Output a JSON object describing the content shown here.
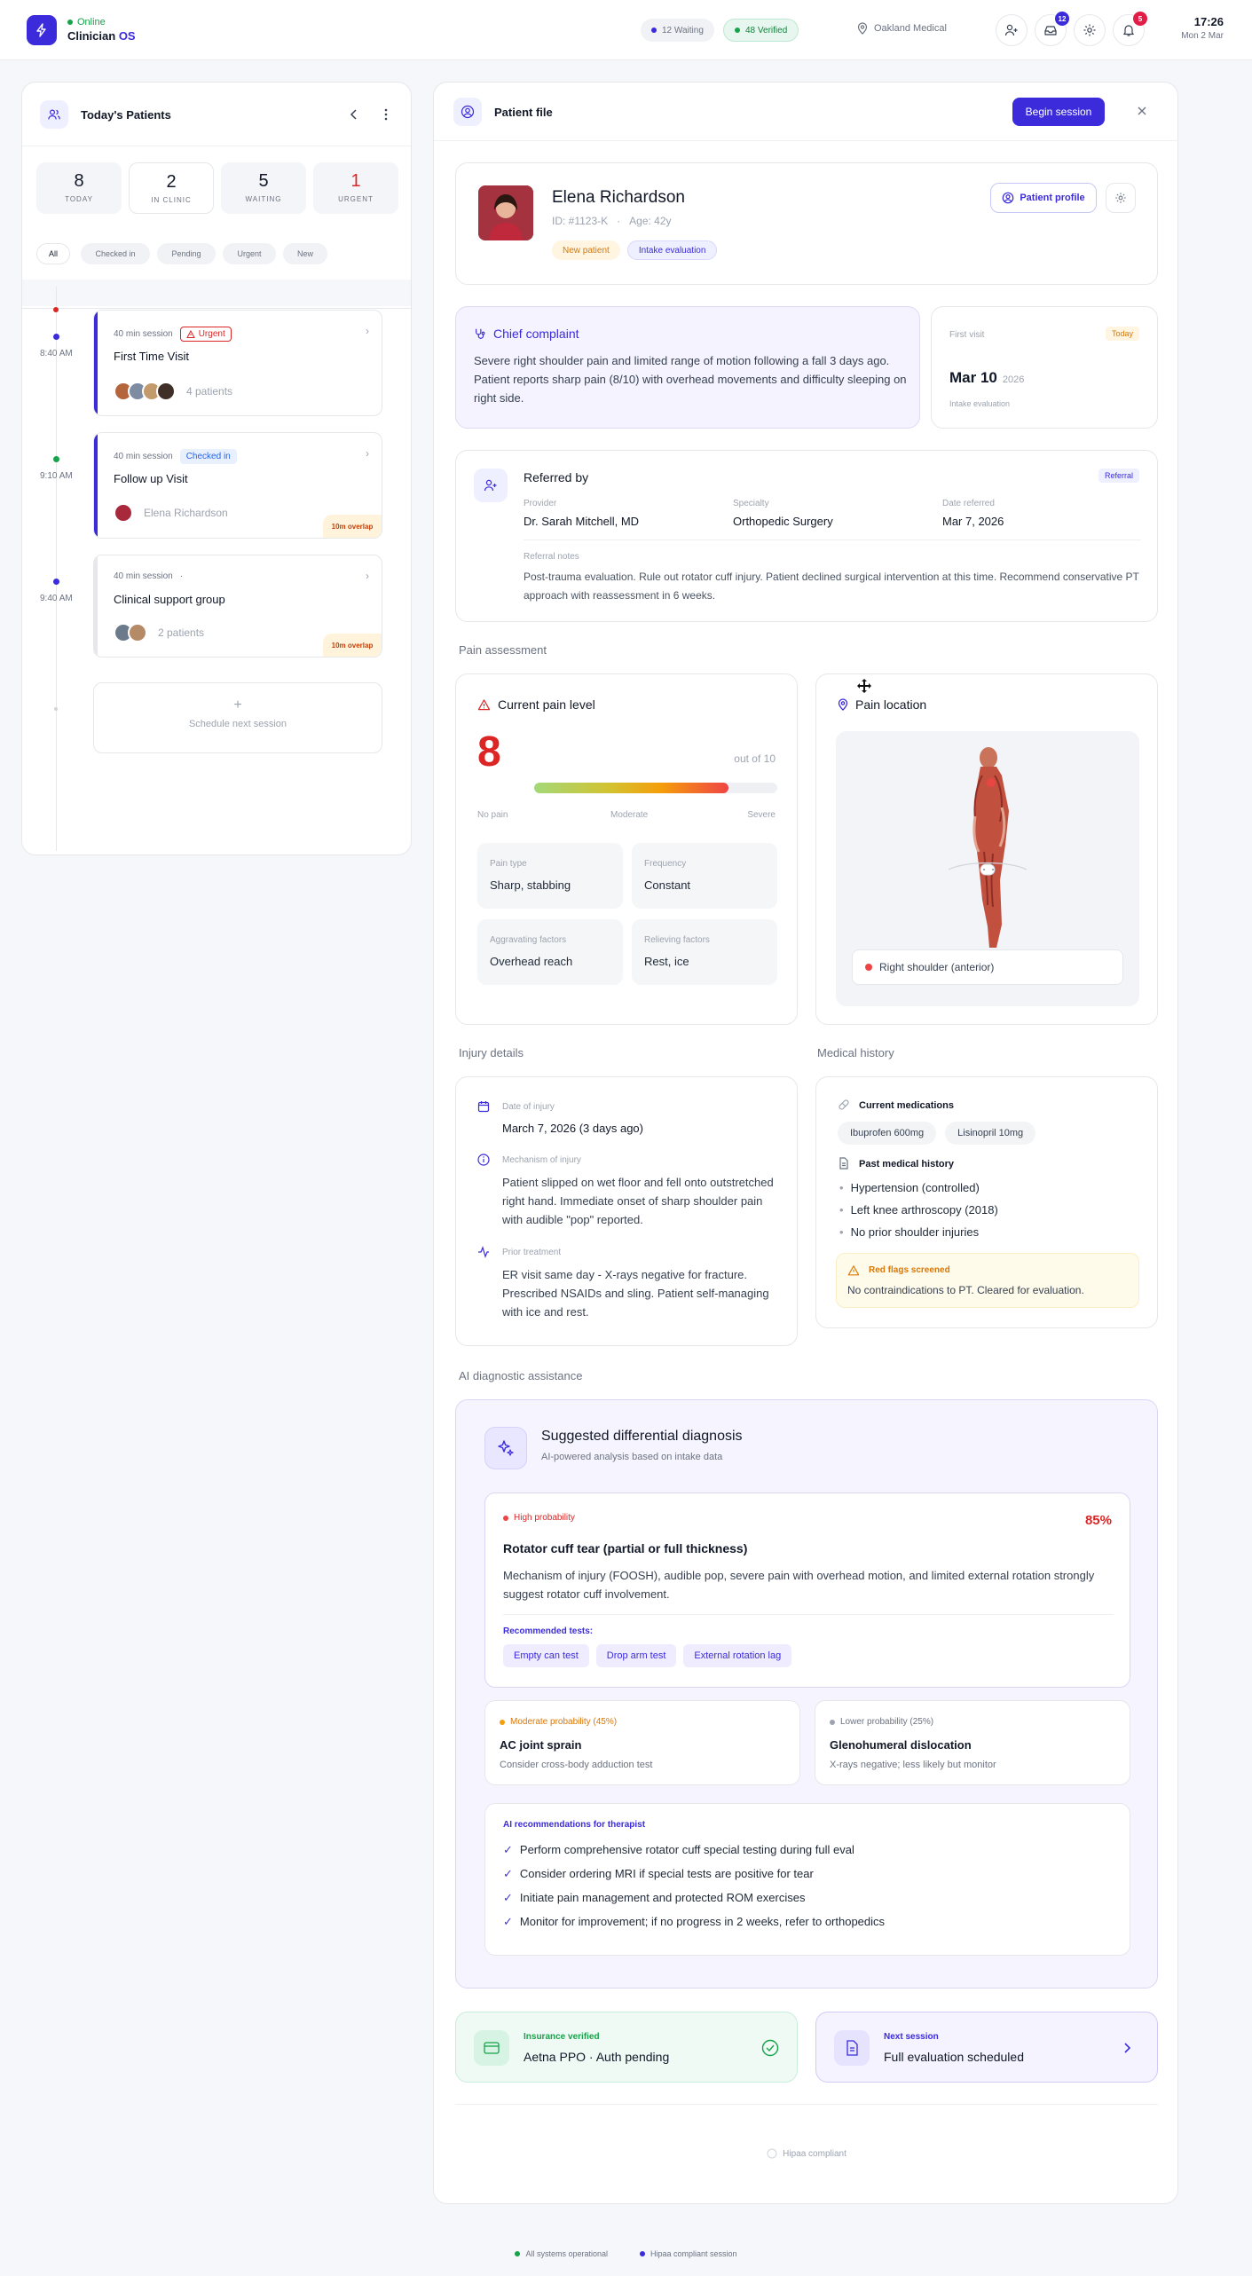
{
  "topbar": {
    "status": "Online",
    "brand_main": "Clinician",
    "brand_accent": "OS",
    "waiting_pill": "12 Waiting",
    "verified_pill": "48 Verified",
    "location": "Oakland Medical",
    "inbox_badge": "12",
    "notif_badge": "5",
    "time": "17:26",
    "date": "Mon 2 Mar"
  },
  "colors": {
    "accent": "#3b2bdb",
    "urgent": "#dc2626",
    "success": "#16a34a",
    "warning": "#f59e0b"
  },
  "left": {
    "title": "Today's Patients",
    "stats": [
      {
        "num": "8",
        "label": "TODAY"
      },
      {
        "num": "2",
        "label": "IN CLINIC"
      },
      {
        "num": "5",
        "label": "WAITING"
      },
      {
        "num": "1",
        "label": "URGENT"
      }
    ],
    "filters": [
      "All",
      "Checked in",
      "Pending",
      "Urgent",
      "New"
    ],
    "sessions": [
      {
        "time": "8:40 AM",
        "duration": "40 min session",
        "tag": "Urgent",
        "name": "First Time Visit",
        "people": "4 patients"
      },
      {
        "time": "9:10 AM",
        "duration": "40 min session",
        "tag": "Checked in",
        "name": "Follow up Visit",
        "people": "Elena Richardson",
        "overlap": "10m overlap"
      },
      {
        "time": "9:40 AM",
        "duration": "40 min session",
        "tag": "·",
        "name": "Clinical support group",
        "people": "2 patients",
        "overlap": "10m overlap"
      }
    ],
    "schedule_plus": "+",
    "schedule_label": "Schedule next session"
  },
  "main": {
    "title": "Patient file",
    "begin": "Begin session",
    "patient": {
      "name": "Elena Richardson",
      "id": "ID: #1123-K",
      "sep": "·",
      "age": "Age: 42y",
      "tags": [
        "New patient",
        "Intake evaluation"
      ],
      "profile_btn": "Patient profile"
    },
    "complaint": {
      "title": "Chief complaint",
      "text": "Severe right shoulder pain and limited range of motion following a fall 3 days ago. Patient reports sharp pain (8/10) with overhead movements and difficulty sleeping on right side."
    },
    "first_visit": {
      "label": "First visit",
      "badge": "Today",
      "date": "Mar 10",
      "year": "2026",
      "type": "Intake evaluation"
    },
    "referral": {
      "title": "Referred by",
      "badge": "Referral",
      "provider_label": "Provider",
      "provider": "Dr. Sarah Mitchell, MD",
      "specialty_label": "Specialty",
      "specialty": "Orthopedic Surgery",
      "date_label": "Date referred",
      "date": "Mar 7, 2026",
      "notes_label": "Referral notes",
      "notes": "Post-trauma evaluation. Rule out rotator cuff injury. Patient declined surgical intervention at this time. Recommend conservative PT approach with reassessment in 6 weeks."
    },
    "pain_section": "Pain assessment",
    "pain": {
      "title": "Current pain level",
      "value": "8",
      "level": 0.8,
      "out_of": "out of 10",
      "scale": [
        "No pain",
        "Moderate",
        "Severe"
      ],
      "fields": [
        {
          "k": "Pain type",
          "v": "Sharp, stabbing"
        },
        {
          "k": "Frequency",
          "v": "Constant"
        },
        {
          "k": "Aggravating factors",
          "v": "Overhead reach"
        },
        {
          "k": "Relieving factors",
          "v": "Rest, ice"
        }
      ]
    },
    "location": {
      "title": "Pain location",
      "marker": "Right shoulder (anterior)"
    },
    "injury_section": "Injury details",
    "injury": {
      "date_label": "Date of injury",
      "date": "March 7, 2026 (3 days ago)",
      "mech_label": "Mechanism of injury",
      "mech": "Patient slipped on wet floor and fell onto outstretched right hand. Immediate onset of sharp shoulder pain with audible \"pop\" reported.",
      "prior_label": "Prior treatment",
      "prior": "ER visit same day - X-rays negative for fracture. Prescribed NSAIDs and sling. Patient self-managing with ice and rest."
    },
    "history_section": "Medical history",
    "history": {
      "meds_label": "Current medications",
      "meds": [
        "Ibuprofen 600mg",
        "Lisinopril 10mg"
      ],
      "past_label": "Past medical history",
      "past": [
        "Hypertension (controlled)",
        "Left knee arthroscopy (2018)",
        "No prior shoulder injuries"
      ],
      "flags_label": "Red flags screened",
      "flags": "No contraindications to PT. Cleared for evaluation."
    },
    "ai_section": "AI diagnostic assistance",
    "ai": {
      "title": "Suggested differential diagnosis",
      "subtitle": "AI-powered analysis based on intake data",
      "primary": {
        "prob_label": "High probability",
        "pct": "85%",
        "name": "Rotator cuff tear (partial or full thickness)",
        "text": "Mechanism of injury (FOOSH), audible pop, severe pain with overhead motion, and limited external rotation strongly suggest rotator cuff involvement.",
        "tests_label": "Recommended tests:",
        "tests": [
          "Empty can test",
          "Drop arm test",
          "External rotation lag"
        ]
      },
      "secondary": [
        {
          "prob": "Moderate probability (45%)",
          "name": "AC joint sprain",
          "note": "Consider cross-body adduction test"
        },
        {
          "prob": "Lower probability (25%)",
          "name": "Glenohumeral dislocation",
          "note": "X-rays negative; less likely but monitor"
        }
      ],
      "rec_label": "AI recommendations for therapist",
      "recs": [
        "Perform comprehensive rotator cuff special testing during full eval",
        "Consider ordering MRI if special tests are positive for tear",
        "Initiate pain management and protected ROM exercises",
        "Monitor for improvement; if no progress in 2 weeks, refer to orthopedics"
      ]
    },
    "insurance": {
      "label": "Insurance verified",
      "value": "Aetna PPO · Auth pending"
    },
    "next": {
      "label": "Next session",
      "value": "Full evaluation scheduled"
    },
    "hipaa": "Hipaa compliant"
  },
  "footer": {
    "left": "All systems operational",
    "right": "Hipaa compliant session"
  }
}
